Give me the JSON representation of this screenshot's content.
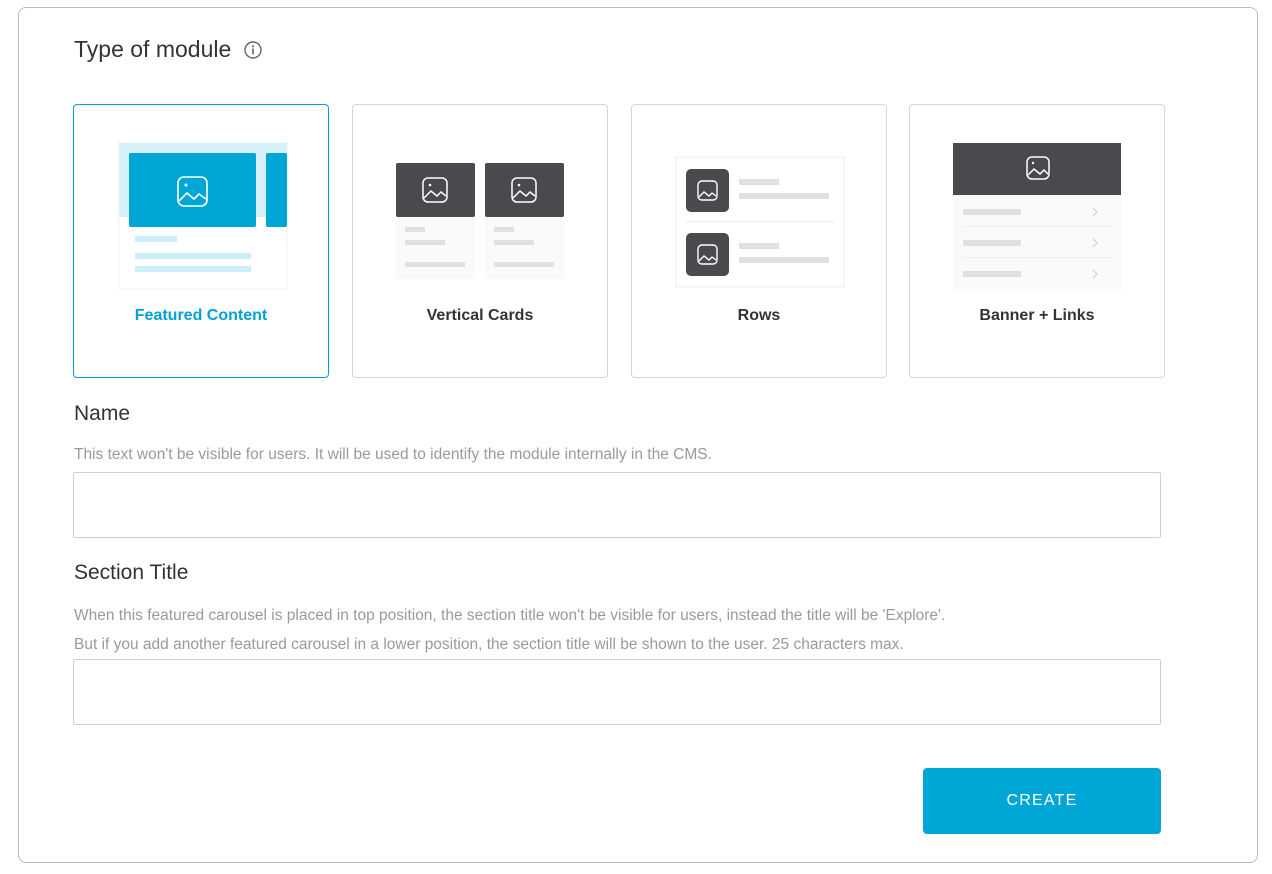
{
  "module_type": {
    "heading": "Type of module",
    "info_icon": "info-circle-icon",
    "options": [
      {
        "label": "Featured Content",
        "selected": true
      },
      {
        "label": "Vertical Cards",
        "selected": false
      },
      {
        "label": "Rows",
        "selected": false
      },
      {
        "label": "Banner + Links",
        "selected": false
      }
    ]
  },
  "name_field": {
    "label": "Name",
    "help": "This text won't be visible for users. It will be used to identify the module internally in the CMS.",
    "value": ""
  },
  "section_title_field": {
    "label": "Section Title",
    "help_line1": "When this featured carousel is placed in top position, the section title won't be visible for users, instead the title will be 'Explore'.",
    "help_line2": "But if you add another featured carousel in a lower position, the section title will be shown to the user. 25 characters max.",
    "value": ""
  },
  "actions": {
    "create_label": "CREATE"
  },
  "colors": {
    "accent": "#00a6d6",
    "dark_tile": "#4a4a4e",
    "muted_text": "#9a9a9a"
  }
}
